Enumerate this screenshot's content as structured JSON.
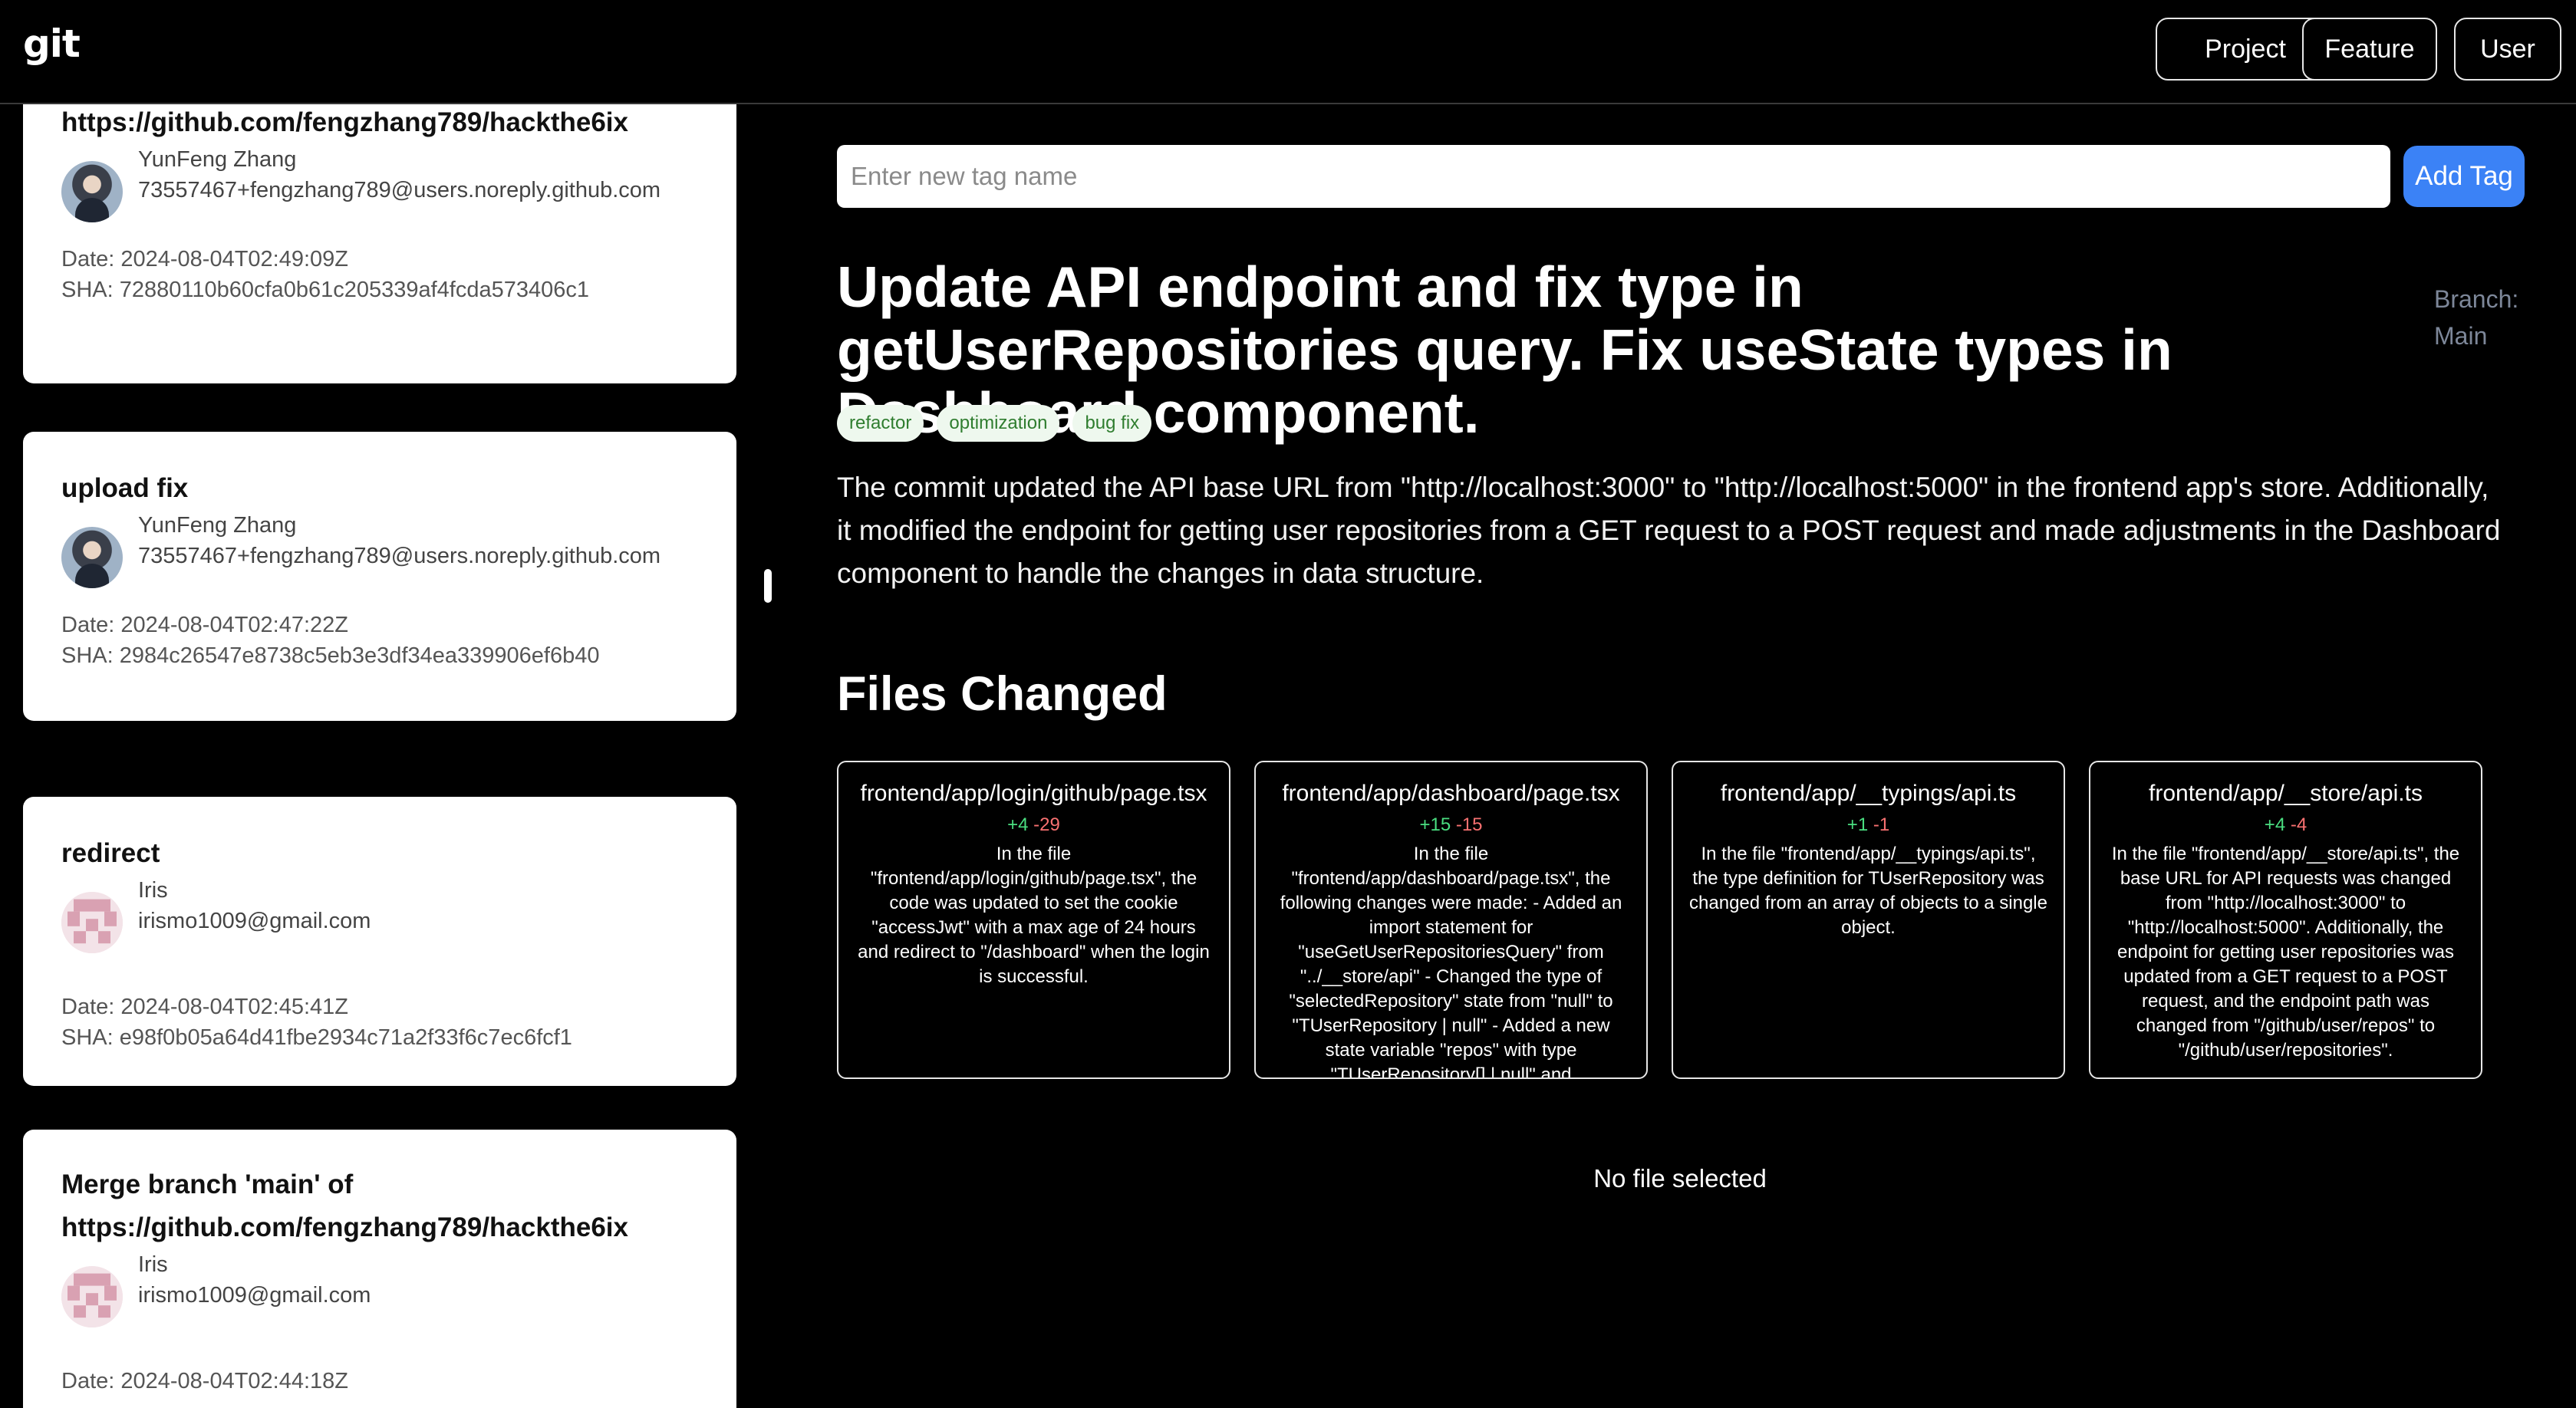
{
  "header": {
    "logo": "git",
    "nav": [
      "Project",
      "Feature",
      "User"
    ]
  },
  "commits": [
    {
      "message": "https://github.com/fengzhang789/hackthe6ix",
      "author_name": "YunFeng Zhang",
      "author_email": "73557467+fengzhang789@users.noreply.github.com",
      "date": "Date: 2024-08-04T02:49:09Z",
      "sha": "SHA: 72880110b60cfa0b61c205339af4fcda573406c1"
    },
    {
      "message": "upload fix",
      "author_name": "YunFeng Zhang",
      "author_email": "73557467+fengzhang789@users.noreply.github.com",
      "date": "Date: 2024-08-04T02:47:22Z",
      "sha": "SHA: 2984c26547e8738c5eb3e3df34ea339906ef6b40"
    },
    {
      "message": "redirect",
      "author_name": "Iris",
      "author_email": "irismo1009@gmail.com",
      "date": "Date: 2024-08-04T02:45:41Z",
      "sha": "SHA: e98f0b05a64d41fbe2934c71a2f33f6c7ec6fcf1"
    },
    {
      "message": "Merge branch 'main' of https://github.com/fengzhang789/hackthe6ix",
      "author_name": "Iris",
      "author_email": "irismo1009@gmail.com",
      "date": "Date: 2024-08-04T02:44:18Z",
      "sha": ""
    }
  ],
  "tag_input": {
    "placeholder": "Enter new tag name",
    "value": ""
  },
  "add_tag_label": "Add Tag",
  "detail": {
    "title": "Update API endpoint and fix type in getUserRepositories query. Fix useState types in Dashboard component.",
    "branch": "Branch: Main",
    "tags": [
      "refactor",
      "optimization",
      "bug fix"
    ],
    "summary": "The commit updated the API base URL from \"http://localhost:3000\" to \"http://localhost:5000\" in the frontend app's store. Additionally, it modified the endpoint for getting user repositories from a GET request to a POST request and made adjustments in the Dashboard component to handle the changes in data structure."
  },
  "files_heading": "Files Changed",
  "files": [
    {
      "name": "frontend/app/login/github/page.tsx",
      "additions": "+4",
      "deletions": "-29",
      "description": "In the file \"frontend/app/login/github/page.tsx\", the code was updated to set the cookie \"accessJwt\" with a max age of 24 hours and redirect to \"/dashboard\" when the login is successful."
    },
    {
      "name": "frontend/app/dashboard/page.tsx",
      "additions": "+15",
      "deletions": "-15",
      "description": "In the file \"frontend/app/dashboard/page.tsx\", the following changes were made: - Added an import statement for \"useGetUserRepositoriesQuery\" from \"../__store/api\" - Changed the type of \"selectedRepository\" state from \"null\" to \"TUserRepository | null\" - Added a new state variable \"repos\" with type \"TUserRepository[] | null\" and"
    },
    {
      "name": "frontend/app/__typings/api.ts",
      "additions": "+1",
      "deletions": "-1",
      "description": "In the file \"frontend/app/__typings/api.ts\", the type definition for TUserRepository was changed from an array of objects to a single object."
    },
    {
      "name": "frontend/app/__store/api.ts",
      "additions": "+4",
      "deletions": "-4",
      "description": "In the file \"frontend/app/__store/api.ts\", the base URL for API requests was changed from \"http://localhost:3000\" to \"http://localhost:5000\". Additionally, the endpoint for getting user repositories was updated from a GET request to a POST request, and the endpoint path was changed from \"/github/user/repos\" to \"/github/user/repositories\"."
    }
  ],
  "no_file_text": "No file selected",
  "colors": {
    "background": "#000000",
    "card": "#ffffff",
    "accent_button": "#3b82f6",
    "additions": "#4ade80",
    "deletions": "#f87171",
    "tag_bg": "#eef8ee",
    "tag_text": "#2f7d2f",
    "branch_text": "#7d8799"
  },
  "icons": [
    "user-avatar-photo",
    "identicon-avatar"
  ]
}
